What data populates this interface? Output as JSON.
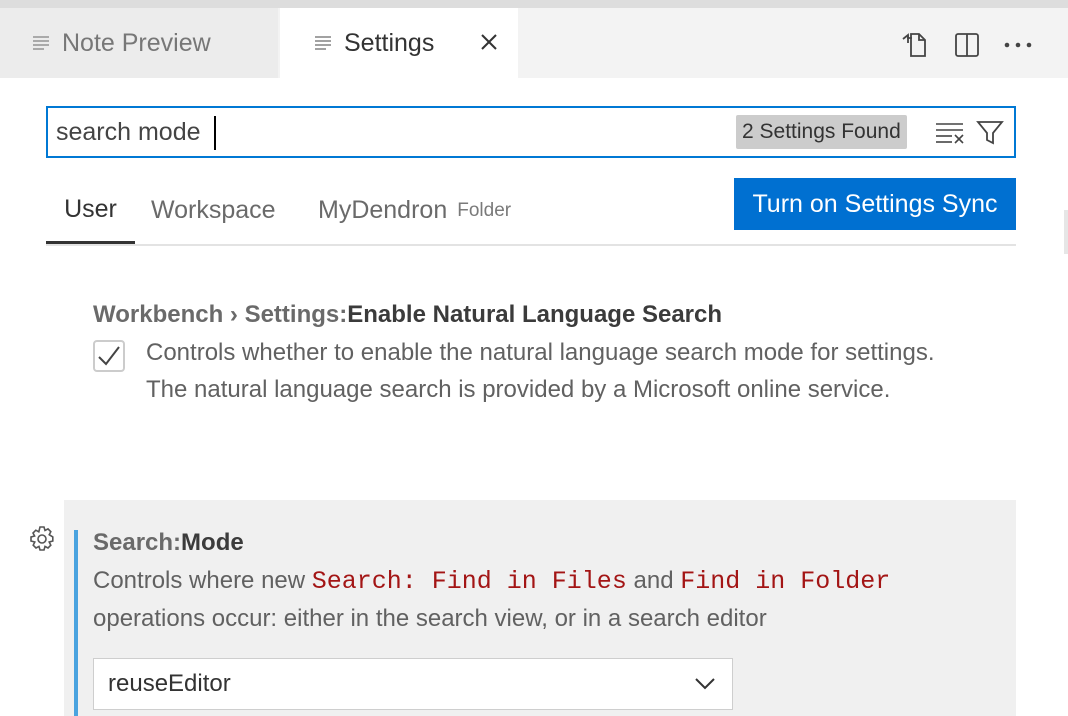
{
  "tabs": [
    {
      "label": "Note Preview",
      "icon": "lines-icon",
      "active": false
    },
    {
      "label": "Settings",
      "icon": "lines-icon",
      "active": true
    }
  ],
  "toolbar": {
    "actions": [
      "open-settings-json-icon",
      "split-editor-icon",
      "more-actions-icon"
    ]
  },
  "search": {
    "value": "search mode",
    "results_badge": "2 Settings Found"
  },
  "scopes": {
    "user": "User",
    "workspace": "Workspace",
    "folder": "MyDendron",
    "folder_sub": "Folder"
  },
  "sync_button": "Turn on Settings Sync",
  "settings": [
    {
      "category": "Workbench › Settings: ",
      "key": "Enable Natural Language Search",
      "checked": true,
      "description": "Controls whether to enable the natural language search mode for settings. The natural language search is provided by a Microsoft online service."
    },
    {
      "category": "Search: ",
      "key": "Mode",
      "desc_prefix": "Controls where new ",
      "code1": "Search: Find in Files",
      "desc_and": " and ",
      "code2": "Find in Folder",
      "desc_suffix": " operations occur: either in the search view, or in a search editor",
      "selected": "reuseEditor"
    }
  ],
  "colors": {
    "accent": "#0078d4",
    "sync_button": "#0070d1",
    "code": "#a31515",
    "modified_bar": "#4aa3df"
  }
}
